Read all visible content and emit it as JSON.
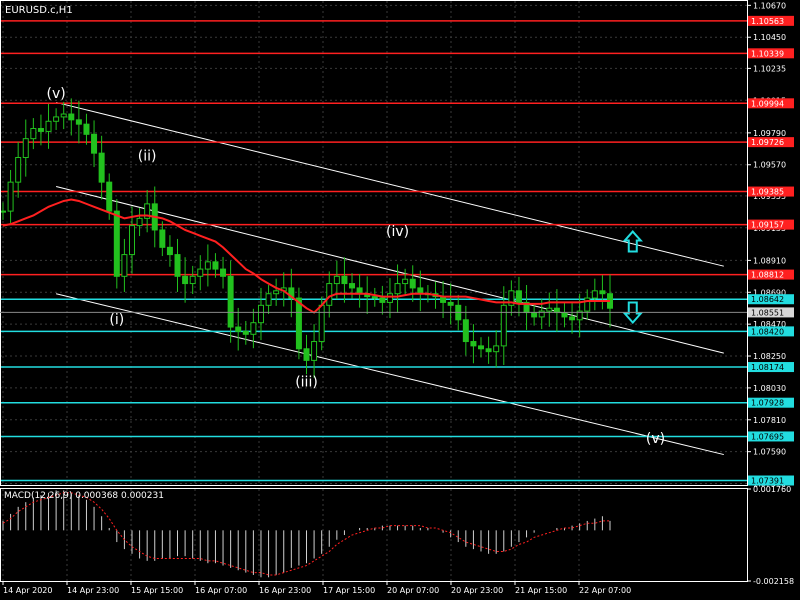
{
  "window": {
    "symbol_label": "EURUSD.c,H1",
    "background": "#000000",
    "grid_color": "#3a3a3a",
    "axis_color": "#ffffff"
  },
  "price_axis": {
    "min": 1.0736,
    "max": 1.107,
    "ticks": [
      "1.10670",
      "1.10450",
      "1.10235",
      "1.10015",
      "1.09790",
      "1.09570",
      "1.09355",
      "1.09135",
      "1.08910",
      "1.08690",
      "1.08470",
      "1.08250",
      "1.08030",
      "1.07810",
      "1.07590",
      "1.07370"
    ],
    "tick_values": [
      1.1067,
      1.1045,
      1.10235,
      1.10015,
      1.0979,
      1.0957,
      1.09355,
      1.09135,
      1.0891,
      1.0869,
      1.0847,
      1.0825,
      1.0803,
      1.0781,
      1.0759,
      1.0737
    ]
  },
  "levels": [
    {
      "value": 1.10563,
      "label": "1.10563",
      "color": "#ff2020",
      "kind": "resistance"
    },
    {
      "value": 1.10339,
      "label": "1.10339",
      "color": "#ff2020",
      "kind": "resistance"
    },
    {
      "value": 1.09994,
      "label": "1.09994",
      "color": "#ff2020",
      "kind": "resistance"
    },
    {
      "value": 1.09726,
      "label": "1.09726",
      "color": "#ff2020",
      "kind": "resistance"
    },
    {
      "value": 1.09385,
      "label": "1.09385",
      "color": "#ff2020",
      "kind": "resistance"
    },
    {
      "value": 1.09157,
      "label": "1.09157",
      "color": "#ff2020",
      "kind": "resistance"
    },
    {
      "value": 1.08812,
      "label": "1.08812",
      "color": "#ff2020",
      "kind": "resistance"
    },
    {
      "value": 1.08642,
      "label": "1.08642",
      "color": "#22dde0",
      "kind": "support"
    },
    {
      "value": 1.0842,
      "label": "1.08420",
      "color": "#22dde0",
      "kind": "support"
    },
    {
      "value": 1.08174,
      "label": "1.08174",
      "color": "#22dde0",
      "kind": "support"
    },
    {
      "value": 1.07928,
      "label": "1.07928",
      "color": "#22dde0",
      "kind": "support"
    },
    {
      "value": 1.07695,
      "label": "1.07695",
      "color": "#22dde0",
      "kind": "support"
    },
    {
      "value": 1.07391,
      "label": "1.07391",
      "color": "#22dde0",
      "kind": "support"
    }
  ],
  "current_price": {
    "value": 1.08551,
    "label": "1.08551"
  },
  "time_axis": {
    "labels": [
      "14 Apr 2020",
      "14 Apr 23:00",
      "15 Apr 15:00",
      "16 Apr 07:00",
      "16 Apr 23:00",
      "17 Apr 15:00",
      "20 Apr 07:00",
      "20 Apr 23:00",
      "21 Apr 15:00",
      "22 Apr 07:00"
    ]
  },
  "wave_labels": [
    {
      "text": "(v)",
      "bar": 7,
      "price": 1.1003
    },
    {
      "text": "(ii)",
      "bar": 19,
      "price": 1.096
    },
    {
      "text": "(i)",
      "bar": 15,
      "price": 1.0847
    },
    {
      "text": "(iii)",
      "bar": 40,
      "price": 1.0804
    },
    {
      "text": "(iv)",
      "bar": 52,
      "price": 1.0908
    },
    {
      "text": "(v)",
      "bar": 86,
      "price": 1.0765
    }
  ],
  "arrows": [
    {
      "name": "up-arrow-icon",
      "direction": "up",
      "bar": 83,
      "price": 1.0904,
      "color": "#22dde0"
    },
    {
      "name": "down-arrow-icon",
      "direction": "down",
      "bar": 83,
      "price": 1.0855,
      "color": "#22dde0"
    }
  ],
  "channel_color": "#ffffff",
  "ma_color": "#ff2020",
  "candle_color": "#22c11e",
  "chart_data": {
    "type": "line",
    "title": "",
    "xlabel": "",
    "ylabel": "",
    "ylim": [
      1.0736,
      1.107
    ],
    "x": [
      0,
      1,
      2,
      3,
      4,
      5,
      6,
      7,
      8,
      9,
      10,
      11,
      12,
      13,
      14,
      15,
      16,
      17,
      18,
      19,
      20,
      21,
      22,
      23,
      24,
      25,
      26,
      27,
      28,
      29,
      30,
      31,
      32,
      33,
      34,
      35,
      36,
      37,
      38,
      39,
      40,
      41,
      42,
      43,
      44,
      45,
      46,
      47,
      48,
      49,
      50,
      51,
      52,
      53,
      54,
      55,
      56,
      57,
      58,
      59,
      60,
      61,
      62,
      63,
      64,
      65,
      66,
      67,
      68,
      69,
      70,
      71,
      72,
      73,
      74,
      75,
      76,
      77,
      78,
      79,
      80
    ],
    "series": [
      {
        "values": [
          1.0925,
          1.0945,
          1.0962,
          1.0975,
          1.0982,
          1.098,
          1.0987,
          1.099,
          1.0992,
          1.0988,
          1.0985,
          1.0978,
          1.0965,
          1.0945,
          1.0925,
          1.088,
          1.0895,
          1.0915,
          1.092,
          1.093,
          1.0912,
          1.09,
          1.0895,
          1.088,
          1.0875,
          1.088,
          1.0885,
          1.089,
          1.0885,
          1.088,
          1.0845,
          1.0842,
          1.084,
          1.0848,
          1.086,
          1.0868,
          1.087,
          1.0872,
          1.0865,
          1.083,
          1.0822,
          1.0835,
          1.086,
          1.0875,
          1.088,
          1.0875,
          1.0872,
          1.0868,
          1.0866,
          1.0865,
          1.0862,
          1.0868,
          1.0875,
          1.0878,
          1.0872,
          1.0868,
          1.0868,
          1.0866,
          1.0862,
          1.086,
          1.085,
          1.0835,
          1.0832,
          1.083,
          1.0828,
          1.0832,
          1.086,
          1.087,
          1.0862,
          1.0855,
          1.0852,
          1.0856,
          1.0858,
          1.0855,
          1.0852,
          1.085,
          1.0856,
          1.0865,
          1.087,
          1.0868,
          1.0858
        ]
      },
      {
        "values": [
          1.0915,
          1.0916,
          1.0918,
          1.092,
          1.0922,
          1.0925,
          1.0928,
          1.093,
          1.0932,
          1.0933,
          1.0932,
          1.093,
          1.0928,
          1.0926,
          1.0924,
          1.0922,
          1.092,
          1.0921,
          1.0922,
          1.0922,
          1.0921,
          1.092,
          1.0918,
          1.0915,
          1.0912,
          1.091,
          1.0908,
          1.0906,
          1.0904,
          1.09,
          1.0895,
          1.089,
          1.0885,
          1.0882,
          1.0878,
          1.0875,
          1.0872,
          1.087,
          1.0866,
          1.0862,
          1.0858,
          1.0855,
          1.086,
          1.0866,
          1.0868,
          1.0868,
          1.0868,
          1.0868,
          1.0868,
          1.0867,
          1.0866,
          1.0866,
          1.0866,
          1.0867,
          1.0868,
          1.0868,
          1.0868,
          1.0867,
          1.0866,
          1.0866,
          1.0866,
          1.0866,
          1.0865,
          1.0864,
          1.0863,
          1.0862,
          1.0862,
          1.0862,
          1.0861,
          1.0861,
          1.0861,
          1.0861,
          1.0862,
          1.0862,
          1.0862,
          1.0862,
          1.0862,
          1.0863,
          1.0863,
          1.0863,
          1.0863
        ]
      }
    ]
  },
  "macd": {
    "label": "MACD(12,26,9) 0.000368 0.000231",
    "ticks": [
      "0.001760",
      "-0.002158"
    ],
    "tick_values": [
      0.00176,
      -0.002158
    ],
    "histogram": [
      0.0004,
      0.0007,
      0.001,
      0.0012,
      0.0014,
      0.0015,
      0.0016,
      0.0017,
      0.0017,
      0.0016,
      0.0015,
      0.0013,
      0.001,
      0.0006,
      0.0001,
      -0.0005,
      -0.0008,
      -0.001,
      -0.0012,
      -0.0013,
      -0.0013,
      -0.0012,
      -0.0012,
      -0.0011,
      -0.0011,
      -0.0012,
      -0.0013,
      -0.0014,
      -0.0014,
      -0.0015,
      -0.0016,
      -0.0017,
      -0.0018,
      -0.0019,
      -0.002,
      -0.002,
      -0.0019,
      -0.0018,
      -0.0016,
      -0.0015,
      -0.0014,
      -0.0012,
      -0.001,
      -0.0007,
      -0.0004,
      -0.0002,
      0.0,
      0.0001,
      0.0001,
      0.0001,
      0.0002,
      0.0002,
      0.0002,
      0.0002,
      0.0002,
      0.0001,
      0.0001,
      0.0,
      -0.0001,
      -0.0003,
      -0.0005,
      -0.0007,
      -0.0008,
      -0.0009,
      -0.001,
      -0.001,
      -0.0009,
      -0.0007,
      -0.0005,
      -0.0003,
      -0.0001,
      0.0,
      0.0,
      0.0001,
      0.0001,
      0.0002,
      0.0003,
      0.0004,
      0.0005,
      0.0006,
      0.0004
    ],
    "signal": [
      0.0003,
      0.0005,
      0.0008,
      0.001,
      0.0012,
      0.0013,
      0.0014,
      0.0015,
      0.0016,
      0.0016,
      0.0015,
      0.0014,
      0.0012,
      0.0009,
      0.0005,
      0.0,
      -0.0004,
      -0.0007,
      -0.0009,
      -0.0011,
      -0.0012,
      -0.0012,
      -0.0012,
      -0.0012,
      -0.0012,
      -0.0012,
      -0.0012,
      -0.0013,
      -0.0013,
      -0.0014,
      -0.0015,
      -0.0016,
      -0.0017,
      -0.0018,
      -0.0018,
      -0.0019,
      -0.0019,
      -0.0018,
      -0.0017,
      -0.0016,
      -0.0015,
      -0.0013,
      -0.0011,
      -0.0009,
      -0.0006,
      -0.0004,
      -0.0002,
      -0.0001,
      0.0,
      0.0001,
      0.0001,
      0.0002,
      0.0002,
      0.0002,
      0.0002,
      0.0002,
      0.0001,
      0.0001,
      0.0,
      -0.0001,
      -0.0003,
      -0.0005,
      -0.0006,
      -0.0007,
      -0.0008,
      -0.0009,
      -0.0009,
      -0.0008,
      -0.0006,
      -0.0005,
      -0.0003,
      -0.0002,
      -0.0001,
      0.0,
      0.0001,
      0.0001,
      0.0002,
      0.0003,
      0.0003,
      0.0004,
      0.0004
    ]
  }
}
